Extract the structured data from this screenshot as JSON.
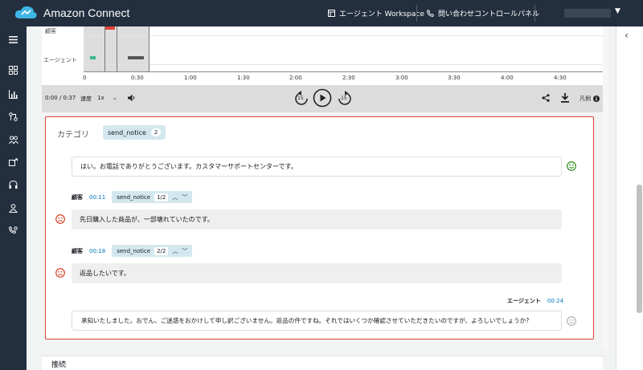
{
  "topbar": {
    "app_title": "Amazon Connect",
    "workspace": "エージェント Workspace",
    "ccp": "問い合わせコントロールパネル"
  },
  "timeline": {
    "rows": [
      "顧客",
      "エージェント"
    ],
    "ticks": [
      "0",
      "0:30",
      "1:00",
      "1:30",
      "2:00",
      "2:30",
      "3:00",
      "3:30",
      "4:00",
      "4:30"
    ]
  },
  "controls": {
    "time": "0:00 / 0:37",
    "speed_label": "速度",
    "speed_value": "1x",
    "back_label": "15",
    "fwd_label": "15",
    "legend": "凡例"
  },
  "categories": {
    "title": "カテゴリ",
    "tag": "send_notice",
    "count": "2"
  },
  "transcript": [
    {
      "speaker": "",
      "time": "",
      "text": "はい。お電話でありがとうございます。カスタマーサポートセンターです。"
    },
    {
      "speaker": "顧客",
      "time": "00:11",
      "tag": "send_notice",
      "page": "1/2",
      "text": "先日購入した商品が、一部壊れていたのです。"
    },
    {
      "speaker": "顧客",
      "time": "00:18",
      "tag": "send_notice",
      "page": "2/2",
      "text": "返品したいです。"
    },
    {
      "speaker": "エージェント",
      "time": "00:24",
      "text": "承知いたしました。おでん、ご迷惑をおかけして申し訳ございません。返品の件ですね。それではいくつか確認させていただきたいのですが、よろしいでしょうか?"
    }
  ],
  "connect_label": "接続",
  "colors": {
    "accent": "#232f3e",
    "highlight": "#e0413a",
    "positive": "#1d8102",
    "negative": "#d13212"
  }
}
